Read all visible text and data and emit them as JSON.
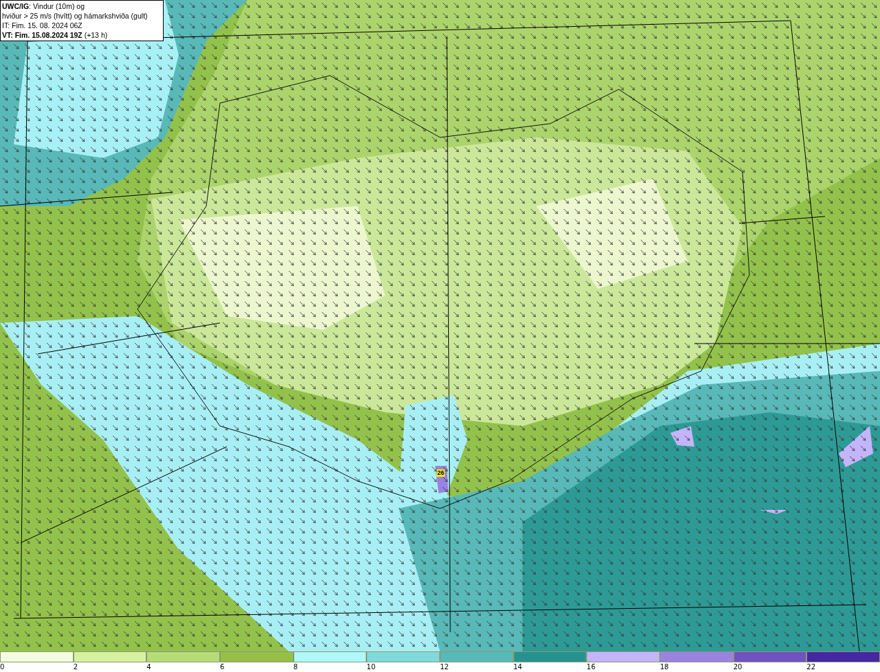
{
  "info_box": {
    "lines": [
      "**UWC/IG**: Vindur (10m) og",
      "hviður > 25 m/s (hvítt) og hámarkshviða (gult)",
      "IT: Fim. 15. 08. 2024 06Z",
      "**VT: Fim. 15.08.2024 19Z** (+13 h)"
    ]
  },
  "map": {
    "gust_label": "26"
  },
  "legend": [
    {
      "label": "0",
      "color": "#f4fbe0"
    },
    {
      "label": "2",
      "color": "#d8f1a0"
    },
    {
      "label": "4",
      "color": "#b5dc78"
    },
    {
      "label": "6",
      "color": "#96bf48"
    },
    {
      "label": "8",
      "color": "#b0f8fc"
    },
    {
      "label": "10",
      "color": "#80d9da"
    },
    {
      "label": "12",
      "color": "#58b9b8"
    },
    {
      "label": "14",
      "color": "#259290"
    },
    {
      "label": "16",
      "color": "#c4b5fa"
    },
    {
      "label": "18",
      "color": "#9a82e0"
    },
    {
      "label": "20",
      "color": "#7052c2"
    },
    {
      "label": "22",
      "color": "#4528a2"
    }
  ]
}
